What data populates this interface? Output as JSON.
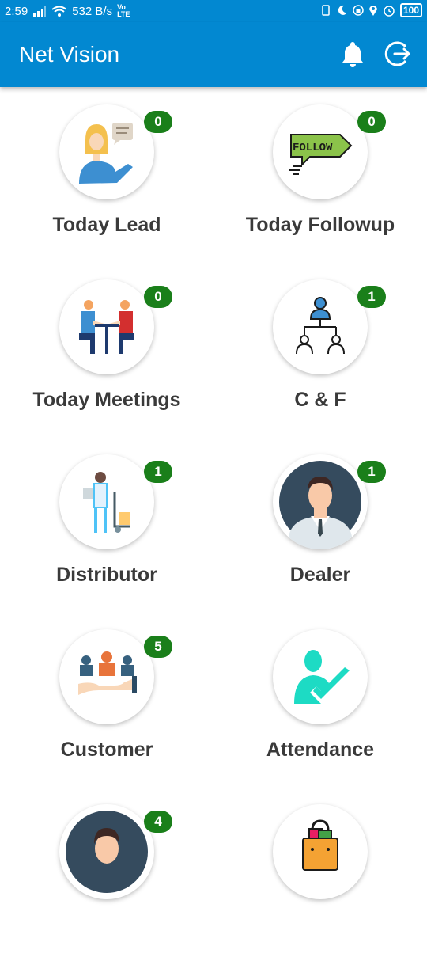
{
  "status_bar": {
    "time": "2:59",
    "speed": "532 B/s",
    "battery": "100"
  },
  "app_bar": {
    "title": "Net Vision",
    "notification_icon": "bell-icon",
    "logout_icon": "logout-icon"
  },
  "accent_color": "#0288d1",
  "badge_color": "#1a7f1a",
  "tiles": [
    {
      "label": "Today Lead",
      "count": "0",
      "icon": "lead-icon"
    },
    {
      "label": "Today Followup",
      "count": "0",
      "icon": "follow-icon"
    },
    {
      "label": "Today Meetings",
      "count": "0",
      "icon": "meeting-icon"
    },
    {
      "label": "C & F",
      "count": "1",
      "icon": "hierarchy-icon"
    },
    {
      "label": "Distributor",
      "count": "1",
      "icon": "distributor-icon"
    },
    {
      "label": "Dealer",
      "count": "1",
      "icon": "dealer-icon"
    },
    {
      "label": "Customer",
      "count": "5",
      "icon": "customer-icon"
    },
    {
      "label": "Attendance",
      "count": "",
      "icon": "attendance-icon"
    },
    {
      "label": "",
      "count": "4",
      "icon": "person-icon"
    },
    {
      "label": "",
      "count": "",
      "icon": "shopping-bag-icon"
    }
  ],
  "follow_sign_text": "FOLLOW"
}
